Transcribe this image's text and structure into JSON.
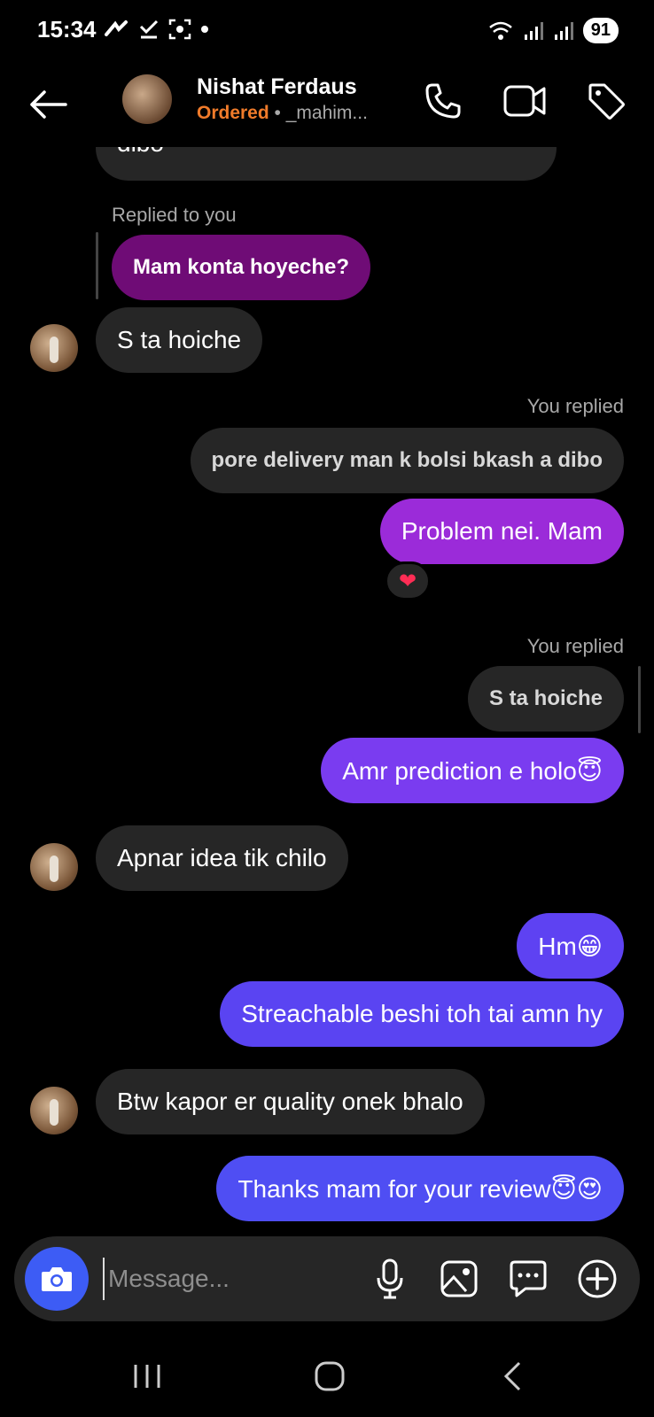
{
  "status_bar": {
    "time": "15:34",
    "battery": "91"
  },
  "header": {
    "contact_name": "Nishat Ferdaus",
    "status": "Ordered",
    "handle": "• _mahim..."
  },
  "messages": {
    "cut_top": "dibo",
    "m1_replied_label": "Replied to you",
    "m1_quote": "Mam konta hoyeche?",
    "m2": "S ta hoiche",
    "m3_replied_label": "You replied",
    "m3_quote": "pore delivery man k bolsi bkash a dibo",
    "m3": "Problem nei. Mam",
    "m3_reaction": "❤",
    "m4_replied_label": "You replied",
    "m4_quote": "S ta hoiche",
    "m4": "Amr prediction e holo😇",
    "m5": "Apnar idea tik chilo",
    "m6": "Hm😁",
    "m7": "Streachable beshi toh tai amn hy",
    "m8": "Btw kapor er quality onek bhalo",
    "m9": "Thanks mam for your review😇😍"
  },
  "composer": {
    "placeholder": "Message..."
  },
  "colors": {
    "bubble_received": "#262626",
    "quote_purple": "#6f0c76",
    "sent_purple_1": "#9b2bd9",
    "sent_purple_2": "#7a3cf0",
    "sent_blue_1": "#5a44f2",
    "sent_blue_2": "#4f4ef3",
    "camera_button": "#3d5cf5",
    "status_orange": "#f07b2a"
  }
}
